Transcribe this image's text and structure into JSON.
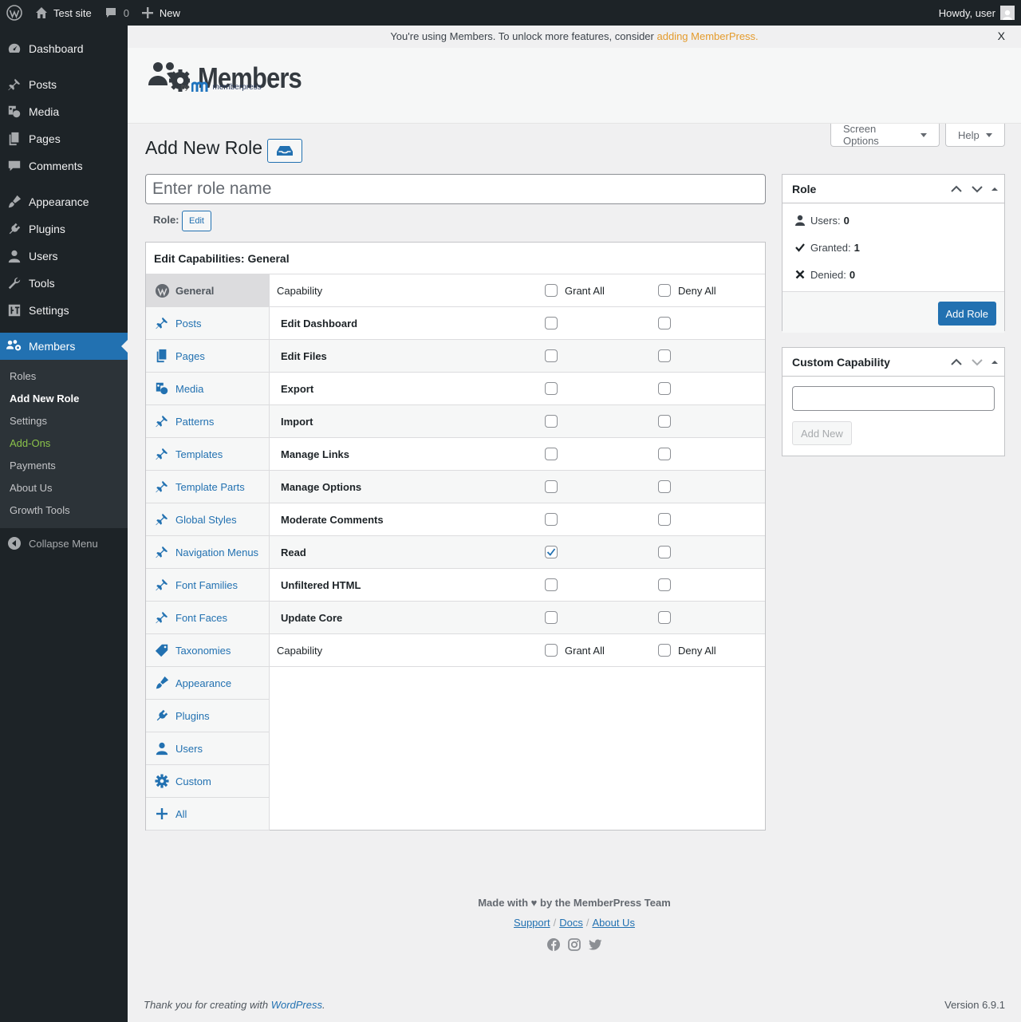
{
  "adminbar": {
    "site_name": "Test site",
    "comments_count": "0",
    "new_label": "New",
    "howdy": "Howdy, user"
  },
  "sidebar": {
    "items": [
      {
        "label": "Dashboard",
        "icon": "dashboard-icon"
      },
      {
        "label": "Posts",
        "icon": "pin-icon"
      },
      {
        "label": "Media",
        "icon": "media-icon"
      },
      {
        "label": "Pages",
        "icon": "pages-icon"
      },
      {
        "label": "Comments",
        "icon": "comment-icon"
      },
      {
        "label": "Appearance",
        "icon": "brush-icon"
      },
      {
        "label": "Plugins",
        "icon": "plug-icon"
      },
      {
        "label": "Users",
        "icon": "user-icon"
      },
      {
        "label": "Tools",
        "icon": "wrench-icon"
      },
      {
        "label": "Settings",
        "icon": "settings-icon"
      },
      {
        "label": "Members",
        "icon": "members-icon"
      }
    ],
    "submenu": [
      "Roles",
      "Add New Role",
      "Settings",
      "Add-Ons",
      "Payments",
      "About Us",
      "Growth Tools"
    ],
    "collapse_label": "Collapse Menu"
  },
  "notice": {
    "text": "You're using Members. To unlock more features, consider",
    "link": "adding MemberPress.",
    "close": "X"
  },
  "brand": {
    "name": "Members",
    "by": "by",
    "mp": "memberpress"
  },
  "screen_options": "Screen Options",
  "help": "Help",
  "page_title": "Add New Role",
  "role_input": {
    "placeholder": "Enter role name",
    "value": ""
  },
  "role_label": "Role:",
  "role_edit": "Edit",
  "caps": {
    "heading": "Edit Capabilities: General",
    "tabs": [
      "General",
      "Posts",
      "Pages",
      "Media",
      "Patterns",
      "Templates",
      "Template Parts",
      "Global Styles",
      "Navigation Menus",
      "Font Families",
      "Font Faces",
      "Taxonomies",
      "Appearance",
      "Plugins",
      "Users",
      "Custom",
      "All"
    ],
    "col_capability": "Capability",
    "col_grant": "Grant All",
    "col_deny": "Deny All",
    "rows": [
      {
        "name": "Edit Dashboard",
        "grant": false,
        "deny": false
      },
      {
        "name": "Edit Files",
        "grant": false,
        "deny": false
      },
      {
        "name": "Export",
        "grant": false,
        "deny": false
      },
      {
        "name": "Import",
        "grant": false,
        "deny": false
      },
      {
        "name": "Manage Links",
        "grant": false,
        "deny": false
      },
      {
        "name": "Manage Options",
        "grant": false,
        "deny": false
      },
      {
        "name": "Moderate Comments",
        "grant": false,
        "deny": false
      },
      {
        "name": "Read",
        "grant": true,
        "deny": false
      },
      {
        "name": "Unfiltered HTML",
        "grant": false,
        "deny": false
      },
      {
        "name": "Update Core",
        "grant": false,
        "deny": false
      }
    ]
  },
  "role_box": {
    "title": "Role",
    "users_label": "Users:",
    "users_value": "0",
    "granted_label": "Granted:",
    "granted_value": "1",
    "denied_label": "Denied:",
    "denied_value": "0",
    "add_role": "Add Role"
  },
  "custom_box": {
    "title": "Custom Capability",
    "input_value": "",
    "add_new": "Add New"
  },
  "mp_footer": {
    "made_with": "Made with ♥ by the MemberPress Team",
    "support": "Support",
    "docs": "Docs",
    "about": "About Us",
    "sep": "/"
  },
  "wp_footer": {
    "thanks_prefix": "Thank you for creating with",
    "wordpress": "WordPress",
    "period": ".",
    "version": "Version 6.9.1"
  },
  "colors": {
    "sidebar_bg": "#1d2327",
    "accent": "#2271b1",
    "addons_green": "#8bc34a",
    "notice_link": "#e49b2c"
  }
}
